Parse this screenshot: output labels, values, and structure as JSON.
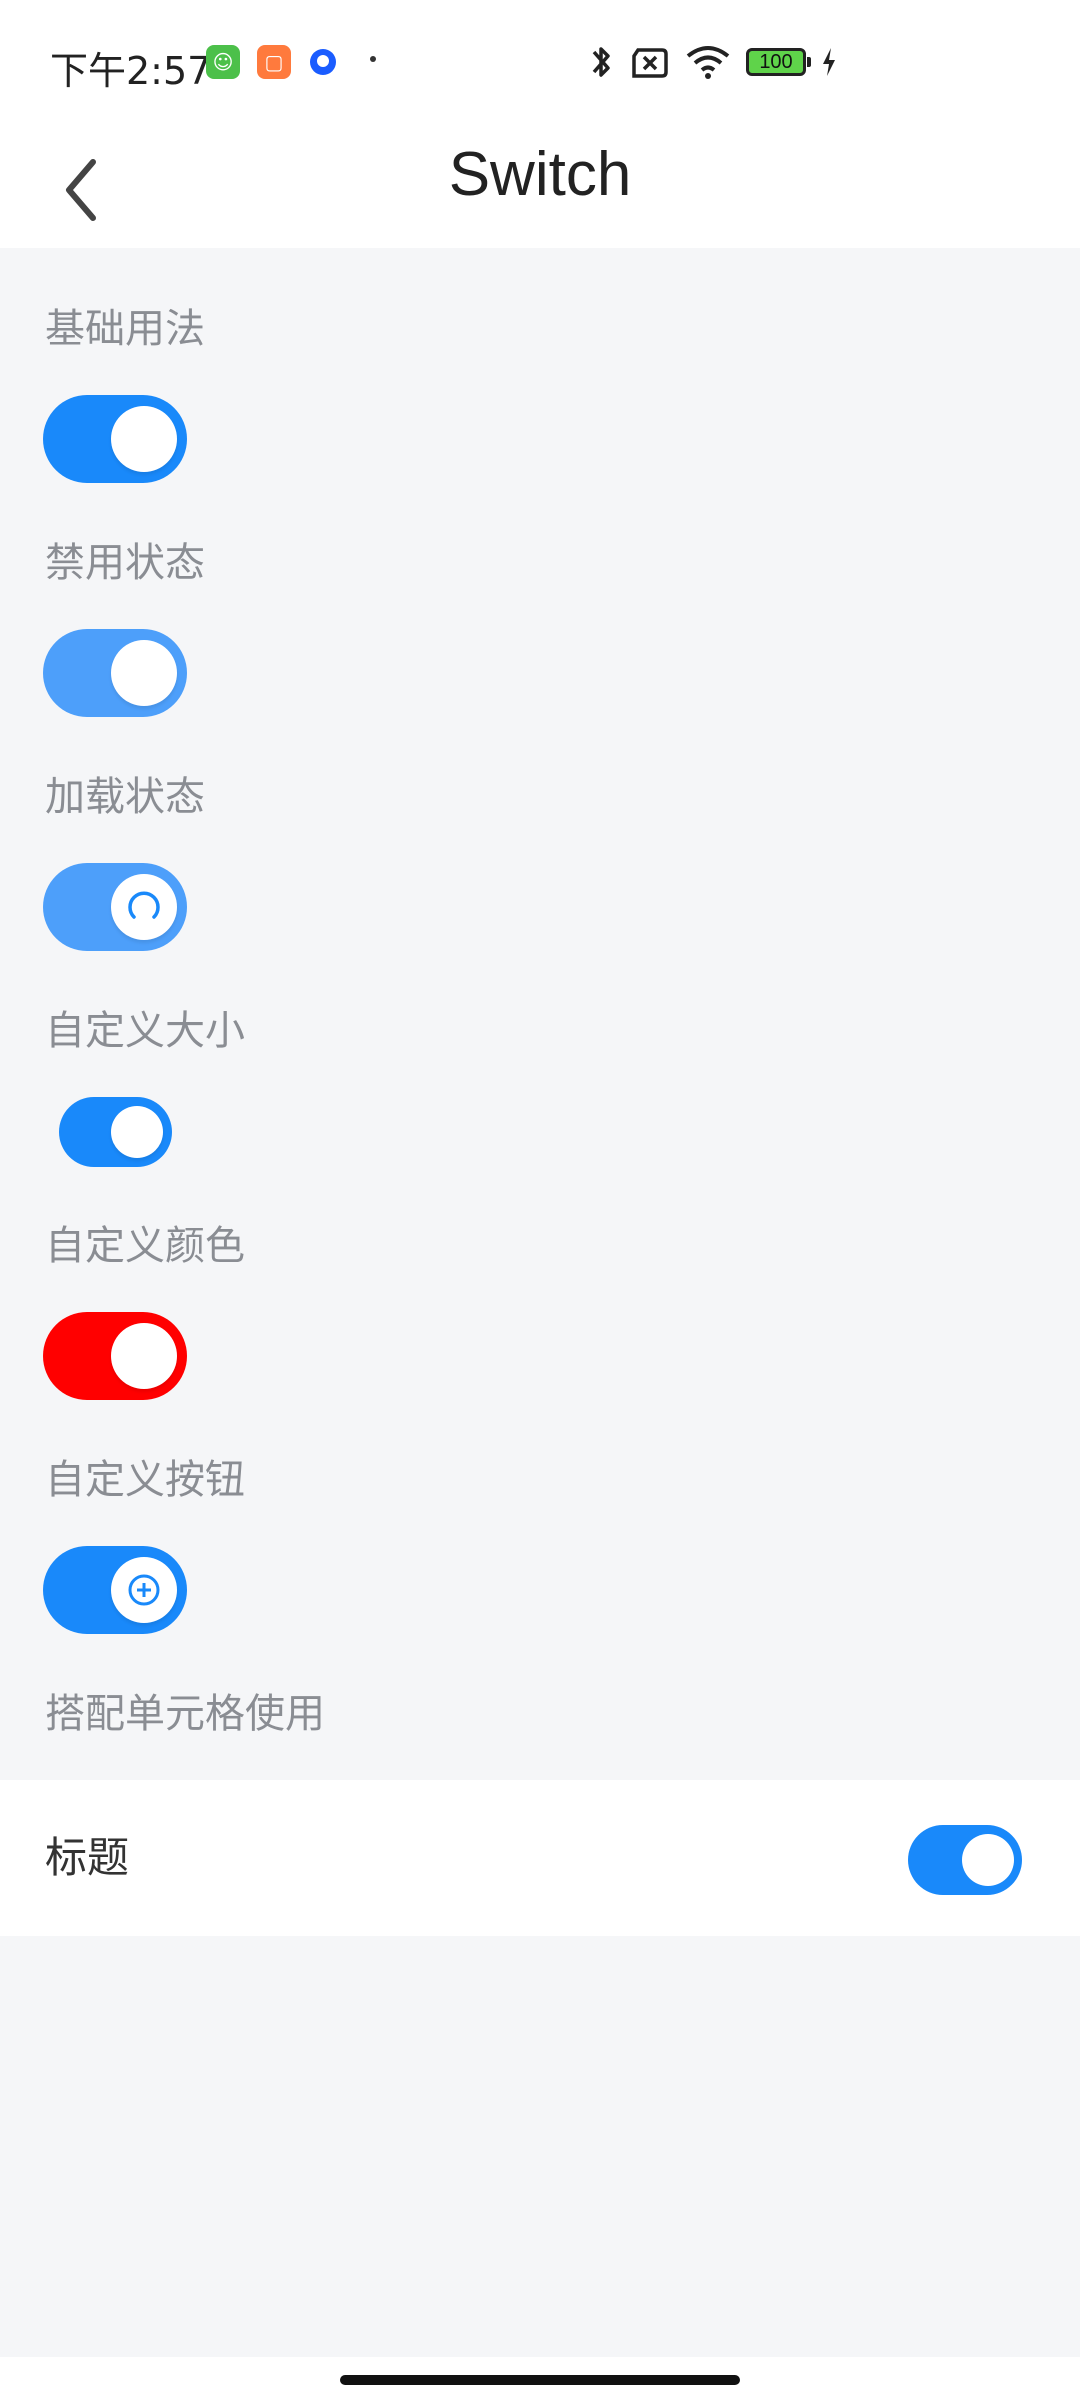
{
  "status_bar": {
    "time": "下午2:57",
    "battery_level": "100",
    "icons": [
      "app-green-icon",
      "app-orange-icon",
      "app-blue-icon",
      "bluetooth-icon",
      "sim-x-icon",
      "wifi-icon",
      "battery-icon",
      "charging-icon"
    ]
  },
  "nav": {
    "title": "Switch",
    "back_icon": "chevron-left-icon"
  },
  "sections": {
    "basic": "基础用法",
    "disabled": "禁用状态",
    "loading": "加载状态",
    "custom_size": "自定义大小",
    "custom_color": "自定义颜色",
    "custom_button": "自定义按钮",
    "with_cell": "搭配单元格使用"
  },
  "switches": {
    "basic": {
      "on": true
    },
    "disabled": {
      "on": true,
      "disabled": true
    },
    "loading": {
      "on": true,
      "loading": true
    },
    "custom_size": {
      "on": true
    },
    "custom_color": {
      "on": true,
      "color": "#ff0000"
    },
    "custom_button": {
      "on": true,
      "knob_icon": "plus-circle-icon"
    }
  },
  "cell": {
    "title": "标题",
    "switch_on": true
  },
  "colors": {
    "accent": "#1989fa",
    "disabled_accent": "#4d9ffa",
    "custom": "#ff0000",
    "page_bg": "#f5f6f8"
  }
}
